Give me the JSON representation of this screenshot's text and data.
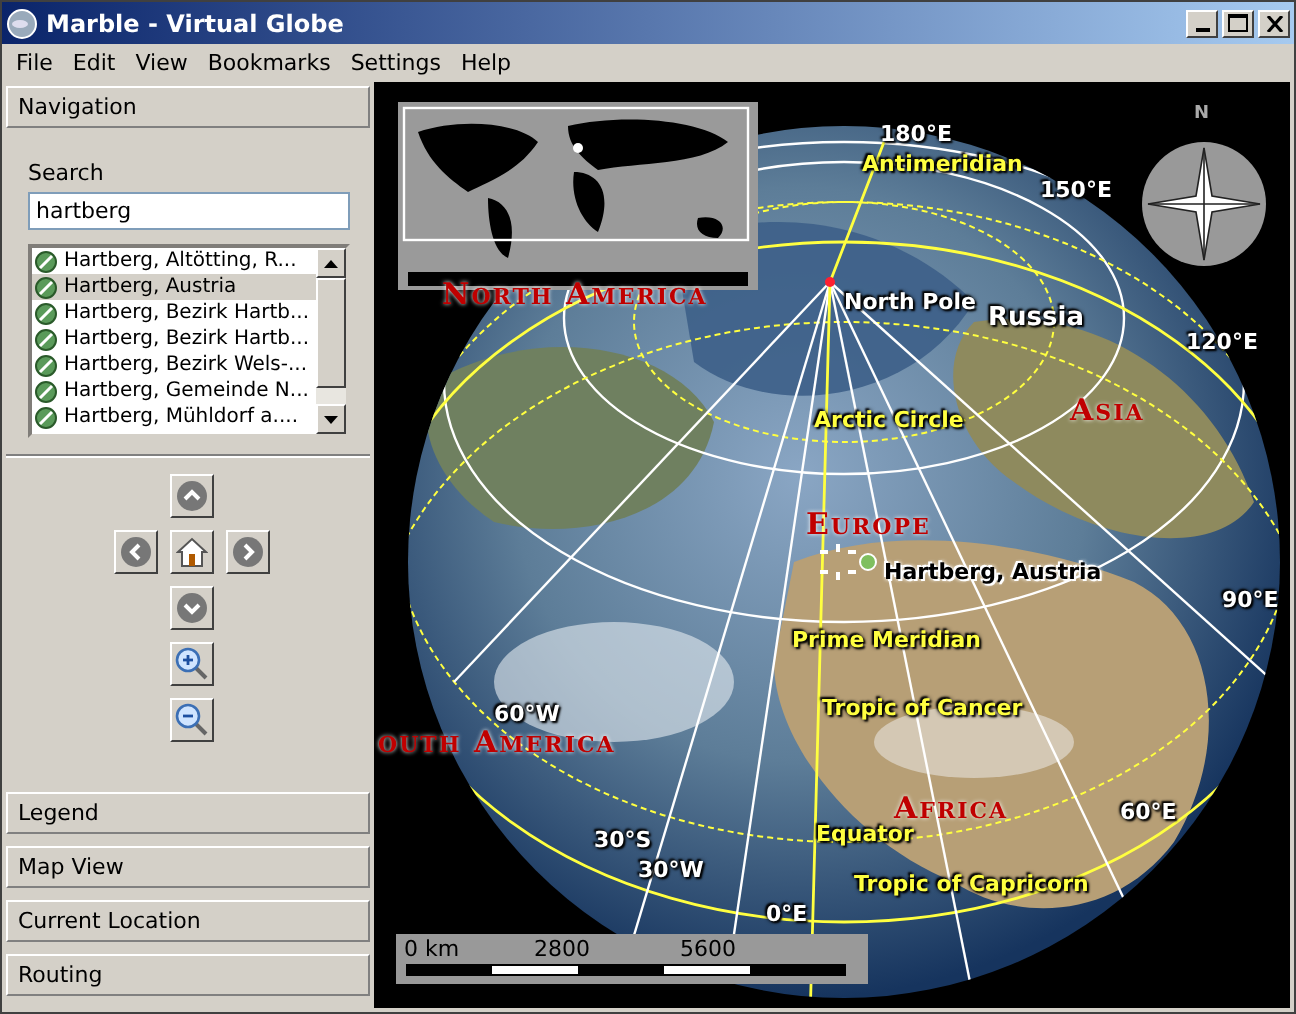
{
  "window": {
    "title": "Marble - Virtual Globe"
  },
  "menu": [
    "File",
    "Edit",
    "View",
    "Bookmarks",
    "Settings",
    "Help"
  ],
  "navigation": {
    "title": "Navigation",
    "search_label": "Search",
    "search": {
      "value": "hartberg"
    },
    "results": [
      {
        "label": "Hartberg, Altötting, R...",
        "selected": false
      },
      {
        "label": "Hartberg, Austria",
        "selected": true
      },
      {
        "label": "Hartberg, Bezirk Hartb...",
        "selected": false
      },
      {
        "label": "Hartberg, Bezirk Hartb...",
        "selected": false
      },
      {
        "label": "Hartberg, Bezirk Wels-...",
        "selected": false
      },
      {
        "label": "Hartberg, Gemeinde N...",
        "selected": false
      },
      {
        "label": "Hartberg, Mühldorf a....",
        "selected": false
      }
    ],
    "buttons": [
      {
        "kind": "up"
      },
      {
        "kind": "left"
      },
      {
        "kind": "home"
      },
      {
        "kind": "right"
      },
      {
        "kind": "down"
      },
      {
        "kind": "zoom-in"
      },
      {
        "kind": "zoom-out"
      }
    ]
  },
  "sections": [
    "Legend",
    "Map View",
    "Current Location",
    "Routing"
  ],
  "map": {
    "labels": [
      {
        "text": "180°E",
        "kind": "grid"
      },
      {
        "text": "Antimeridian",
        "kind": "circle"
      },
      {
        "text": "150°E",
        "kind": "grid"
      },
      {
        "text": "North Pole",
        "kind": "pole"
      },
      {
        "text": "Russia",
        "kind": "country"
      },
      {
        "text": "120°E",
        "kind": "grid"
      },
      {
        "text": "Asia",
        "kind": "continent"
      },
      {
        "text": "North America",
        "kind": "continent"
      },
      {
        "text": "Arctic Circle",
        "kind": "circle"
      },
      {
        "text": "Europe",
        "kind": "continent"
      },
      {
        "text": "Hartberg, Austria",
        "kind": "place"
      },
      {
        "text": "90°E",
        "kind": "grid"
      },
      {
        "text": "Prime Meridian",
        "kind": "circle"
      },
      {
        "text": "60°W",
        "kind": "grid"
      },
      {
        "text": "Tropic of Cancer",
        "kind": "circle"
      },
      {
        "text": "outh America",
        "kind": "continent"
      },
      {
        "text": "Africa",
        "kind": "continent"
      },
      {
        "text": "60°E",
        "kind": "grid"
      },
      {
        "text": "30°S",
        "kind": "grid"
      },
      {
        "text": "30°W",
        "kind": "grid"
      },
      {
        "text": "Equator",
        "kind": "circle"
      },
      {
        "text": "Tropic of Capricorn",
        "kind": "circle"
      },
      {
        "text": "0°E",
        "kind": "grid"
      }
    ],
    "compass": {
      "label": "N"
    },
    "scale_bar": {
      "ticks": [
        "0 km",
        "2800",
        "5600"
      ]
    }
  }
}
